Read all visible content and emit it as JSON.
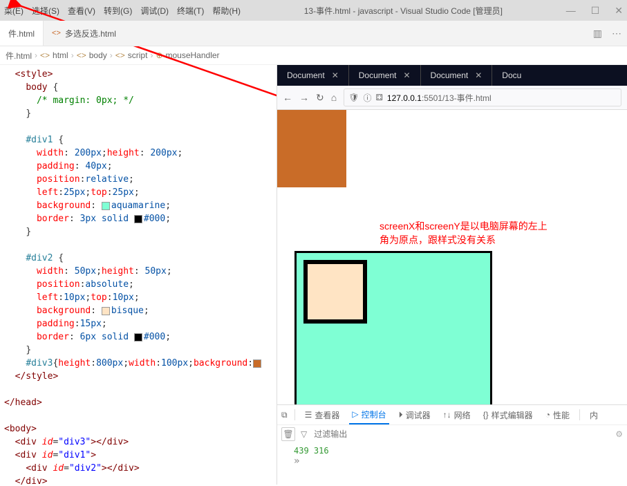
{
  "titlebar": {
    "menus": [
      "菜(E)",
      "选择(S)",
      "查看(V)",
      "转到(G)",
      "调试(D)",
      "终端(T)",
      "帮助(H)"
    ],
    "title": "13-事件.html - javascript - Visual Studio Code [管理员]"
  },
  "tabs": [
    {
      "label": "件.html",
      "active": true
    },
    {
      "label": "多选反选.html",
      "active": false
    }
  ],
  "breadcrumbs": [
    "件.html",
    "html",
    "body",
    "script",
    "mouseHandler"
  ],
  "code": {
    "l1": "<style>",
    "l2_sel": "body",
    "l2_br": " {",
    "l3": "/* margin: 0px; */",
    "l4": "}",
    "d1_sel": "#div1",
    "br_open": " {",
    "d1_p1k": "width",
    "d1_p1v": "200px",
    "d1_p1k2": "height",
    "d1_p1v2": "200px",
    "d1_p2k": "padding",
    "d1_p2v": "40px",
    "d1_p3k": "position",
    "d1_p3v": "relative",
    "d1_p4k": "left",
    "d1_p4v": "25px",
    "d1_p4k2": "top",
    "d1_p4v2": "25px",
    "d1_p5k": "background",
    "d1_p5v": "aquamarine",
    "d1_p6k": "border",
    "d1_p6v": "3px solid ",
    "d1_p6v2": "#000",
    "br_close": "}",
    "d2_sel": "#div2",
    "d2_p1k": "width",
    "d2_p1v": "50px",
    "d2_p1k2": "height",
    "d2_p1v2": "50px",
    "d2_p2k": "position",
    "d2_p2v": "absolute",
    "d2_p3k": "left",
    "d2_p3v": "10px",
    "d2_p3k2": "top",
    "d2_p3v2": "10px",
    "d2_p4k": "background",
    "d2_p4v": "bisque",
    "d2_p5k": "padding",
    "d2_p5v": "15px",
    "d2_p6k": "border",
    "d2_p6v": "6px solid ",
    "d2_p6v2": "#000",
    "d3_sel": "#div3",
    "d3_p1k": "height",
    "d3_p1v": "800px",
    "d3_p2k": "width",
    "d3_p2v": "100px",
    "d3_p3k": "background",
    "style_close": "</style>",
    "head_close": "</head>",
    "body_open": "<body>",
    "div3_open": "<div ",
    "id_attr": "id",
    "div3_id": "\"div3\"",
    "tag_selfclose": "></div>",
    "div1_open": "<div ",
    "div1_id": "\"div1\"",
    "close_gt": ">",
    "div2_open": "<div ",
    "div2_id": "\"div2\"",
    "div_close": "</div>"
  },
  "browser": {
    "tabs": [
      "Document",
      "Document",
      "Document",
      "Docu"
    ],
    "url_host": "127.0.0.1",
    "url_port": ":5501/13-事件.html",
    "shield": "⛉",
    "info": "ⓘ",
    "perm": "⚙"
  },
  "annotation": {
    "line1": "screenX和screenY是以电脑屏幕的左上",
    "line2": "角为原点，跟样式没有关系"
  },
  "devtools": {
    "tabs": [
      "查看器",
      "控制台",
      "调试器",
      "网络",
      "样式编辑器",
      "性能",
      "内"
    ],
    "filter_placeholder": "过滤输出",
    "console_output": "439 316"
  }
}
